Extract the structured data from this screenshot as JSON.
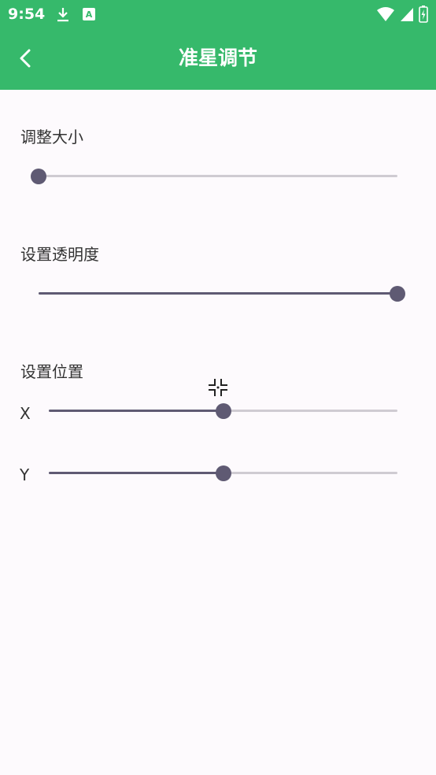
{
  "status_bar": {
    "time": "9:54",
    "left_icons": [
      "download-icon",
      "text-a-icon"
    ],
    "right_icons": [
      "wifi-icon",
      "signal-icon",
      "battery-icon"
    ]
  },
  "toolbar": {
    "title": "准星调节",
    "back_icon": "chevron-left-icon",
    "background_color": "#36b96b"
  },
  "size_section": {
    "label": "调整大小",
    "value_fraction": 0.0
  },
  "opacity_section": {
    "label": "设置透明度",
    "value_fraction": 1.0
  },
  "position_section": {
    "label": "设置位置",
    "crosshair_icon": "crosshair-icon",
    "x": {
      "label": "X",
      "value_fraction": 0.5
    },
    "y": {
      "label": "Y",
      "value_fraction": 0.5
    }
  },
  "colors": {
    "slider_active": "#5f5a73",
    "slider_inactive": "#cfcbd2",
    "page_background": "#fdfafd"
  }
}
